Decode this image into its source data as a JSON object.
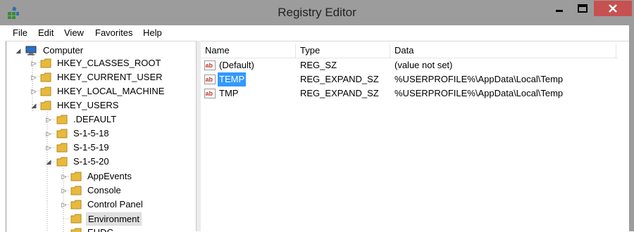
{
  "window": {
    "title": "Registry Editor",
    "icons": {
      "app": "registry-editor-icon",
      "minimize": "minimize-icon",
      "maximize": "maximize-icon",
      "close": "close-icon"
    },
    "colors": {
      "titlebar": "#9c9c9c",
      "close_button": "#c75050",
      "selection": "#3399ff"
    }
  },
  "menu": {
    "file": "File",
    "edit": "Edit",
    "view": "View",
    "favorites": "Favorites",
    "help": "Help"
  },
  "tree": {
    "computer": "Computer",
    "hkcr": "HKEY_CLASSES_ROOT",
    "hkcu": "HKEY_CURRENT_USER",
    "hklm": "HKEY_LOCAL_MACHINE",
    "hku": "HKEY_USERS",
    "default": ".DEFAULT",
    "s18": "S-1-5-18",
    "s19": "S-1-5-19",
    "s20": "S-1-5-20",
    "appevents": "AppEvents",
    "console": "Console",
    "control_panel": "Control Panel",
    "environment": "Environment",
    "partial": "EUDC"
  },
  "list": {
    "columns": {
      "name": "Name",
      "type": "Type",
      "data": "Data"
    },
    "rows": [
      {
        "name": "(Default)",
        "type": "REG_SZ",
        "data": "(value not set)"
      },
      {
        "name": "TEMP",
        "type": "REG_EXPAND_SZ",
        "data": "%USERPROFILE%\\AppData\\Local\\Temp"
      },
      {
        "name": "TMP",
        "type": "REG_EXPAND_SZ",
        "data": "%USERPROFILE%\\AppData\\Local\\Temp"
      }
    ]
  }
}
